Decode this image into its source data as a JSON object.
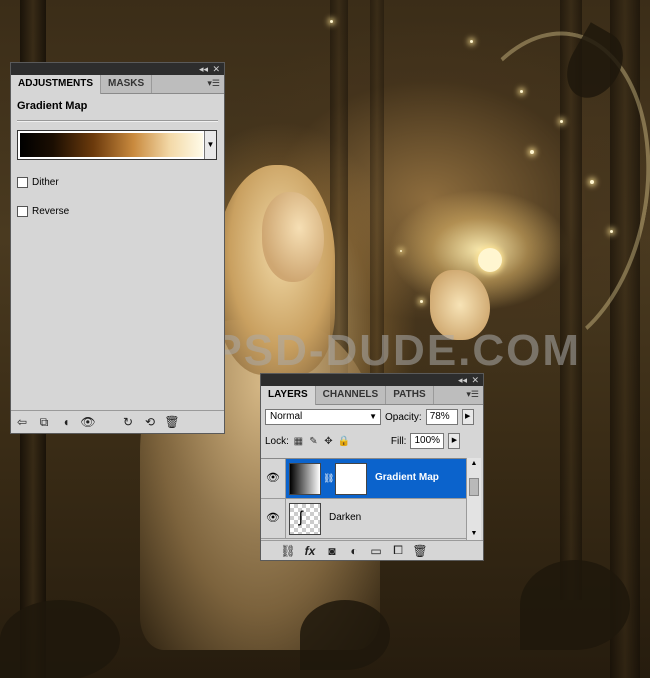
{
  "background": {
    "watermark": "WWW.PSD-DUDE.COM"
  },
  "adjustments_panel": {
    "tabs": [
      "ADJUSTMENTS",
      "MASKS"
    ],
    "title": "Gradient Map",
    "dither_label": "Dither",
    "dither_checked": false,
    "reverse_label": "Reverse",
    "reverse_checked": false,
    "gradient_colors": [
      "#000000",
      "#6b3a0c",
      "#c98a3e",
      "#f3d9a8",
      "#fffbe8"
    ],
    "bottom_icons": [
      "return-arrow-icon",
      "clip-layer-icon",
      "mask-visibility-icon",
      "eye-icon",
      "view-previous-icon",
      "reset-icon",
      "trash-icon"
    ]
  },
  "layers_panel": {
    "tabs": [
      "LAYERS",
      "CHANNELS",
      "PATHS"
    ],
    "blend_mode": "Normal",
    "opacity_label": "Opacity:",
    "opacity_value": "78%",
    "lock_label": "Lock:",
    "fill_label": "Fill:",
    "fill_value": "100%",
    "layers": [
      {
        "name": "Gradient Map",
        "selected": true,
        "visible": true,
        "type": "adjustment"
      },
      {
        "name": "Darken",
        "selected": false,
        "visible": true,
        "type": "pixel"
      }
    ],
    "bottom_icons": [
      "link-icon",
      "fx-icon",
      "add-mask-icon",
      "new-adjustment-icon",
      "new-group-icon",
      "new-layer-icon",
      "trash-icon"
    ]
  },
  "colors": {
    "selection": "#0b63cc",
    "panel_bg": "#d6d6d6",
    "titlebar": "#2d2d2d"
  }
}
